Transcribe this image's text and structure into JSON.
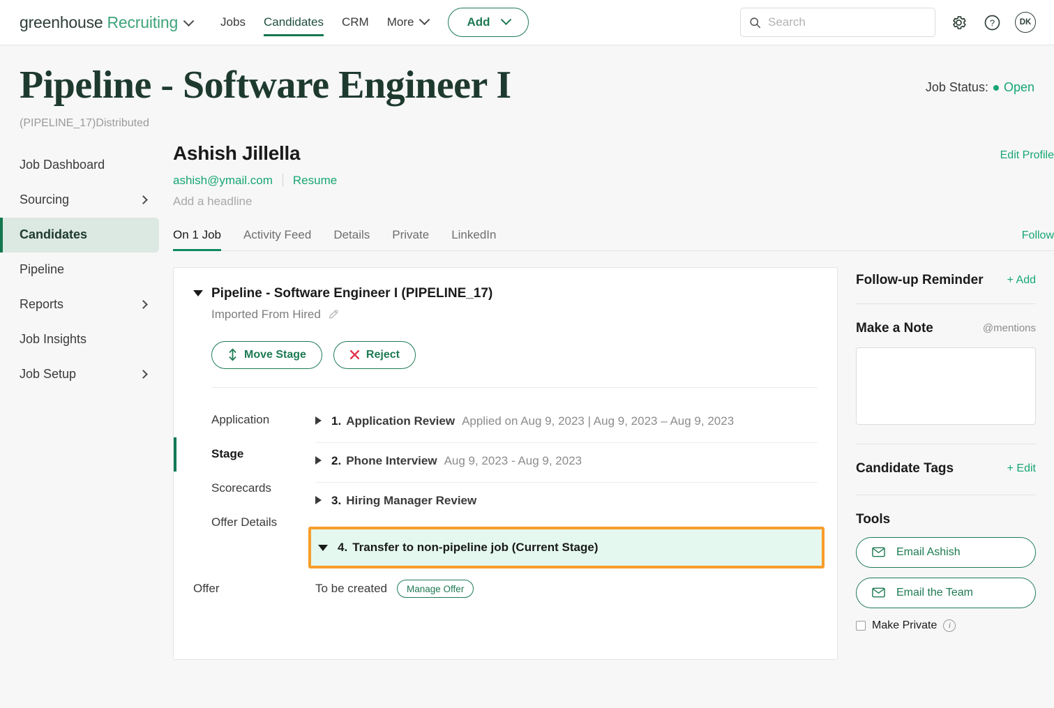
{
  "topnav": {
    "brand_primary": "greenhouse",
    "brand_secondary": "Recruiting",
    "links": [
      {
        "label": "Jobs",
        "active": false
      },
      {
        "label": "Candidates",
        "active": true
      },
      {
        "label": "CRM",
        "active": false
      }
    ],
    "more_label": "More",
    "add_label": "Add",
    "search_placeholder": "Search",
    "search_value": "",
    "avatar_initials": "DK"
  },
  "page": {
    "title": "Pipeline - Software Engineer I",
    "subtitle": "(PIPELINE_17)Distributed",
    "status_label": "Job Status:",
    "status_value": "Open",
    "status_color": "#17A673"
  },
  "sidebar": {
    "items": [
      {
        "label": "Job Dashboard",
        "chevron": false,
        "active": false
      },
      {
        "label": "Sourcing",
        "chevron": true,
        "active": false
      },
      {
        "label": "Candidates",
        "chevron": false,
        "active": true
      },
      {
        "label": "Pipeline",
        "chevron": false,
        "active": false
      },
      {
        "label": "Reports",
        "chevron": true,
        "active": false
      },
      {
        "label": "Job Insights",
        "chevron": false,
        "active": false
      },
      {
        "label": "Job Setup",
        "chevron": true,
        "active": false
      }
    ]
  },
  "candidate": {
    "name": "Ashish Jillella",
    "email": "ashish@ymail.com",
    "resume_label": "Resume",
    "headline_placeholder": "Add a headline",
    "edit_profile_label": "Edit Profile",
    "follow_label": "Follow"
  },
  "tabs": [
    {
      "label": "On 1 Job",
      "active": true
    },
    {
      "label": "Activity Feed",
      "active": false
    },
    {
      "label": "Details",
      "active": false
    },
    {
      "label": "Private",
      "active": false
    },
    {
      "label": "LinkedIn",
      "active": false
    }
  ],
  "card": {
    "title": "Pipeline - Software Engineer I (PIPELINE_17)",
    "source": "Imported From Hired",
    "move_stage_label": "Move Stage",
    "reject_label": "Reject",
    "subnav": [
      {
        "label": "Application",
        "active": false
      },
      {
        "label": "Stage",
        "active": true
      },
      {
        "label": "Scorecards",
        "active": false
      },
      {
        "label": "Offer Details",
        "active": false
      }
    ],
    "stages": [
      {
        "number": "1.",
        "name": "Application Review",
        "meta": "Applied on Aug 9, 2023 | Aug 9, 2023 – Aug 9, 2023",
        "expanded": false,
        "highlighted": false
      },
      {
        "number": "2.",
        "name": "Phone Interview",
        "meta": "Aug 9, 2023 - Aug 9, 2023",
        "expanded": false,
        "highlighted": false
      },
      {
        "number": "3.",
        "name": "Hiring Manager Review",
        "meta": "",
        "expanded": false,
        "highlighted": false
      },
      {
        "number": "4.",
        "name": "Transfer to non-pipeline job (Current Stage)",
        "meta": "",
        "expanded": true,
        "highlighted": true
      }
    ],
    "offer": {
      "label": "Offer",
      "status": "To be created",
      "button_label": "Manage Offer"
    },
    "highlight_border_color": "#F79E2B",
    "highlight_bg_color": "#E4F8EF"
  },
  "rail": {
    "followup_title": "Follow-up Reminder",
    "followup_action": "+ Add",
    "note_title": "Make a Note",
    "note_mentions": "@mentions",
    "note_value": "",
    "tags_title": "Candidate Tags",
    "tags_action": "+ Edit",
    "tools_title": "Tools",
    "email_candidate_label": "Email Ashish",
    "email_team_label": "Email the Team",
    "make_private_label": "Make Private"
  }
}
